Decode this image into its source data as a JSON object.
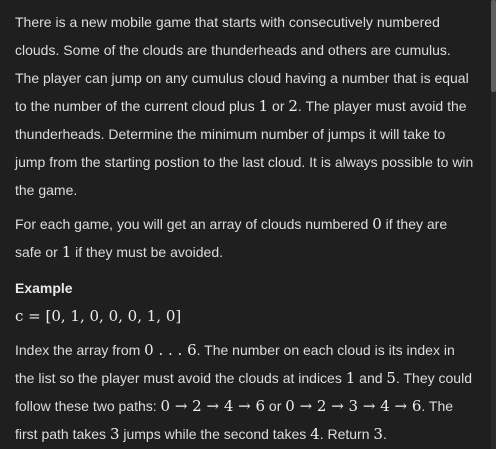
{
  "problem": {
    "para1": {
      "t1": "There is a new mobile game that starts with consecutively numbered clouds. Some of the clouds are thunderheads and others are cumulus. The player can jump on any cumulus cloud having a number that is equal to the number of the current cloud plus ",
      "m1": "1",
      "t2": " or ",
      "m2": "2",
      "t3": ". The player must avoid the thunderheads. Determine the minimum number of jumps it will take to jump from the starting postion to the last cloud. It is always possible to win the game."
    },
    "para2": {
      "t1": "For each game, you will get an array of clouds numbered ",
      "m1": "0",
      "t2": " if they are safe or ",
      "m2": "1",
      "t3": " if they must be avoided."
    },
    "example_heading": "Example",
    "example_equation": "c = [0, 1, 0, 0, 0, 1, 0]",
    "para3": {
      "t1": "Index the array from ",
      "m1": "0 . . . 6",
      "t2": ". The number on each cloud is its index in the list so the player must avoid the clouds at indices ",
      "m2": "1",
      "t3": " and ",
      "m3": "5",
      "t4": ". They could follow these two paths: ",
      "m4": "0 → 2 → 4 → 6",
      "t5": " or ",
      "m5": "0 → 2 → 3 → 4 → 6",
      "t6": ". The first path takes ",
      "m6": "3",
      "t7": " jumps while the second takes ",
      "m7": "4",
      "t8": ". Return ",
      "m8": "3",
      "t9": "."
    }
  }
}
